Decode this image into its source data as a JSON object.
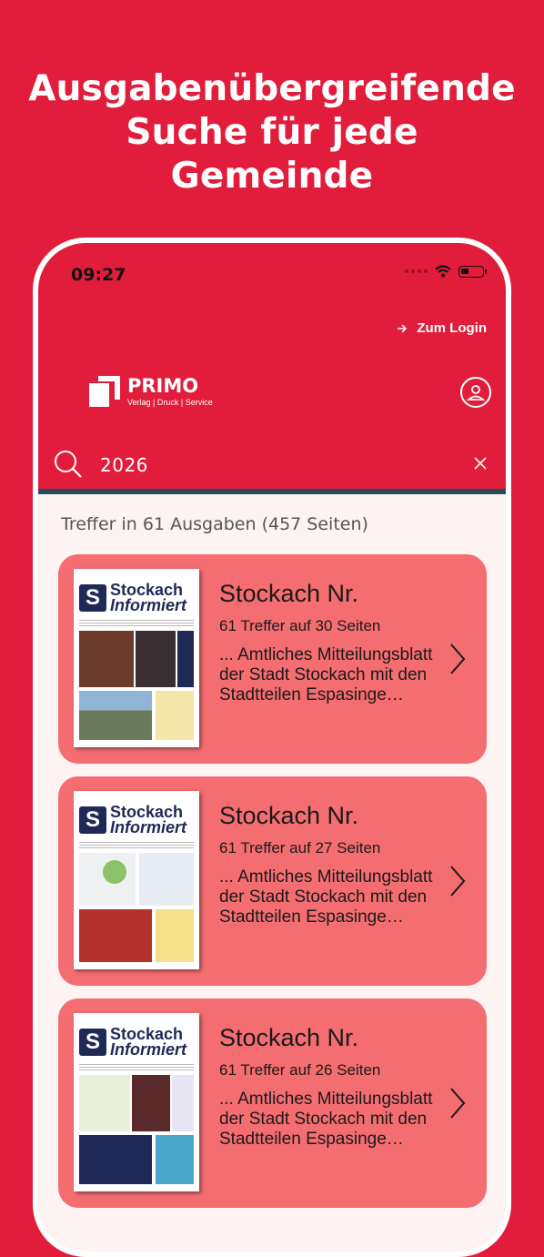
{
  "headline": [
    "Ausgabenübergreifende",
    "Suche für jede",
    "Gemeinde"
  ],
  "status": {
    "time": "09:27"
  },
  "header": {
    "login_label": "Zum Login",
    "logo_brand": "PRIMO",
    "logo_tagline": "Verlag | Druck | Service"
  },
  "search": {
    "value": "2026"
  },
  "results": {
    "summary": "Treffer in 61 Ausgaben (457 Seiten)",
    "items": [
      {
        "title": "Stockach Nr.",
        "hits": "61 Treffer auf 30 Seiten",
        "snippet": "... Amtliches Mitteilungsblatt der Stadt Stockach mit den Stadtteilen Espasinge…"
      },
      {
        "title": "Stockach Nr.",
        "hits": "61 Treffer auf 27 Seiten",
        "snippet": "... Amtliches Mitteilungsblatt der Stadt Stockach mit den Stadtteilen Espasinge…"
      },
      {
        "title": "Stockach Nr.",
        "hits": "61 Treffer auf 26 Seiten",
        "snippet": "... Amtliches Mitteilungsblatt der Stadt Stockach mit den Stadtteilen Espasinge…"
      }
    ]
  },
  "thumbnail": {
    "letter": "S",
    "line1": "Stockach",
    "line2": "Informiert"
  },
  "colors": {
    "brand_red": "#e11d3b",
    "card": "#f46d71",
    "accent_line": "#2a4c5a"
  }
}
